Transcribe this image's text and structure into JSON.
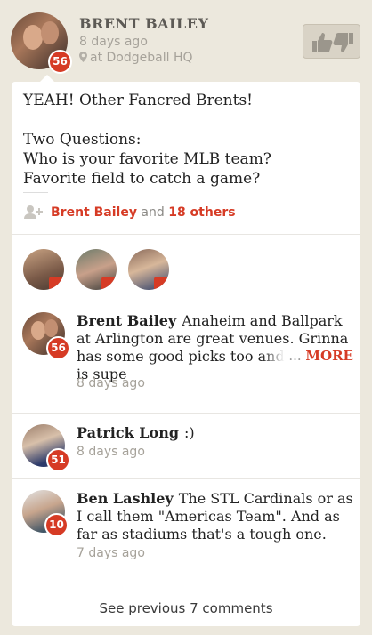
{
  "poster": {
    "name": "BRENT BAILEY",
    "time": "8 days ago",
    "location": "at Dodgeball HQ",
    "badge": "56"
  },
  "post": {
    "text": "YEAH! Other Fancred Brents!\n\nTwo Questions:\nWho is your favorite MLB team?\nFavorite field to catch a game?"
  },
  "likes": {
    "first_liker": "Brent Bailey",
    "conjunction": "and",
    "others": "18 others"
  },
  "comments": [
    {
      "name": "Brent Bailey",
      "text": "Anaheim and Ballpark at Arlington are great venues.  Grinna has some good picks too and Camden is supe",
      "more": "MORE",
      "ellipsis": "...",
      "time": "8 days ago",
      "badge": "56"
    },
    {
      "name": "Patrick Long",
      "text": ":)",
      "time": "8 days ago",
      "badge": "51"
    },
    {
      "name": "Ben Lashley",
      "text": "The STL Cardinals or as I call them \"Americas Team\". And as far as stadiums that's a tough one.",
      "time": "7 days ago",
      "badge": "10"
    }
  ],
  "see_previous": "See previous 7 comments",
  "colors": {
    "accent": "#d63b25",
    "background": "#ece8dd"
  }
}
